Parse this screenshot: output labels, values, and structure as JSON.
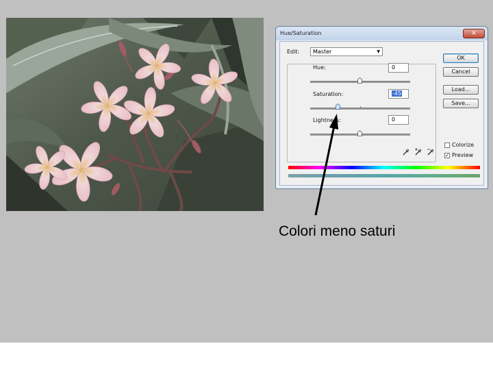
{
  "dialog": {
    "title": "Hue/Saturation",
    "close_icon": "close-icon",
    "edit_label": "Edit:",
    "edit_value": "Master",
    "hue_label": "Hue:",
    "hue_value": "0",
    "saturation_label": "Saturation:",
    "saturation_value": "-45",
    "lightness_label": "Lightness:",
    "lightness_value": "0",
    "ok_label": "OK",
    "cancel_label": "Cancel",
    "load_label": "Load...",
    "save_label": "Save...",
    "colorize_label": "Colorize",
    "colorize_checked": false,
    "preview_label": "Preview",
    "preview_checked": true,
    "eyedropper_icons": [
      "eyedropper-icon",
      "eyedropper-plus-icon",
      "eyedropper-minus-icon"
    ]
  },
  "caption": "Colori meno saturi",
  "colors": {
    "slide_background": "#c0c0c0",
    "dialog_background": "#f0f0f0",
    "selection": "#3a6fd3"
  }
}
